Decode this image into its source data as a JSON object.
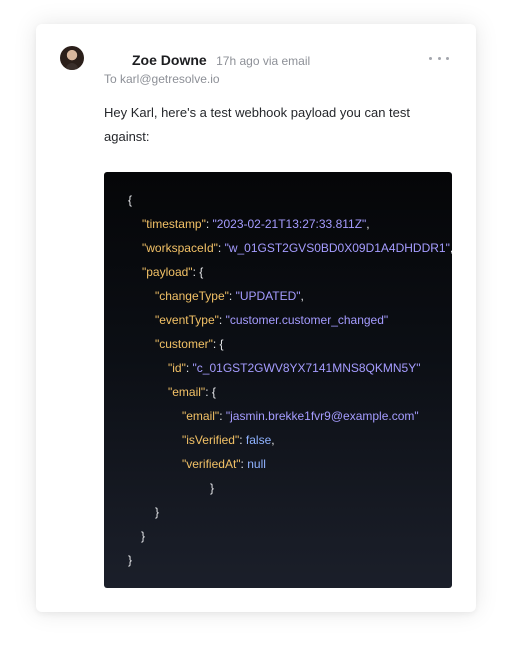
{
  "message": {
    "sender_name": "Zoe Downe",
    "meta": "17h ago via email",
    "recipient": "To karl@getresolve.io",
    "body": "Hey Karl, here's a test webhook payload you can test against:"
  },
  "icons": {
    "more": "more-horizontal-icon"
  },
  "colors": {
    "background": "#ffffff",
    "code_background": "#0b0d12",
    "json_key": "#f2c166",
    "json_string": "#a59cff",
    "json_keyword": "#8fb2ff",
    "json_punctuation": "#e8e9ec"
  },
  "code": {
    "lines": [
      [
        "{",
        "",
        "",
        ""
      ],
      [
        "\"timestamp\"",
        ": ",
        "\"2023-02-21T13:27:33.811Z\"",
        ","
      ],
      [
        "\"workspaceId\"",
        ": ",
        "\"w_01GST2GVS0BD0X09D1A4DHDDR1\"",
        ","
      ],
      [
        "\"payload\"",
        ": ",
        "",
        "{"
      ],
      [
        "\"changeType\"",
        ": ",
        "\"UPDATED\"",
        ","
      ],
      [
        "\"eventType\"",
        ": ",
        "\"customer.customer_changed\"",
        ""
      ],
      [
        "\"customer\"",
        ": ",
        "",
        "{"
      ],
      [
        "\"id\"",
        ": ",
        "\"c_01GST2GWV8YX7141MNS8QKMN5Y\"",
        ""
      ],
      [
        "\"email\"",
        ": ",
        "",
        "{"
      ],
      [
        "\"email\"",
        ": ",
        "\"jasmin.brekke1fvr9@example.com\"",
        ""
      ],
      [
        "\"isVerified\"",
        ": ",
        "false",
        ","
      ],
      [
        "\"verifiedAt\"",
        ": ",
        "null",
        ""
      ],
      [
        "}",
        "",
        "",
        ""
      ],
      [
        "}",
        "",
        "",
        ""
      ],
      [
        "}",
        "",
        "",
        ""
      ],
      [
        "}",
        "",
        "",
        ""
      ]
    ]
  }
}
